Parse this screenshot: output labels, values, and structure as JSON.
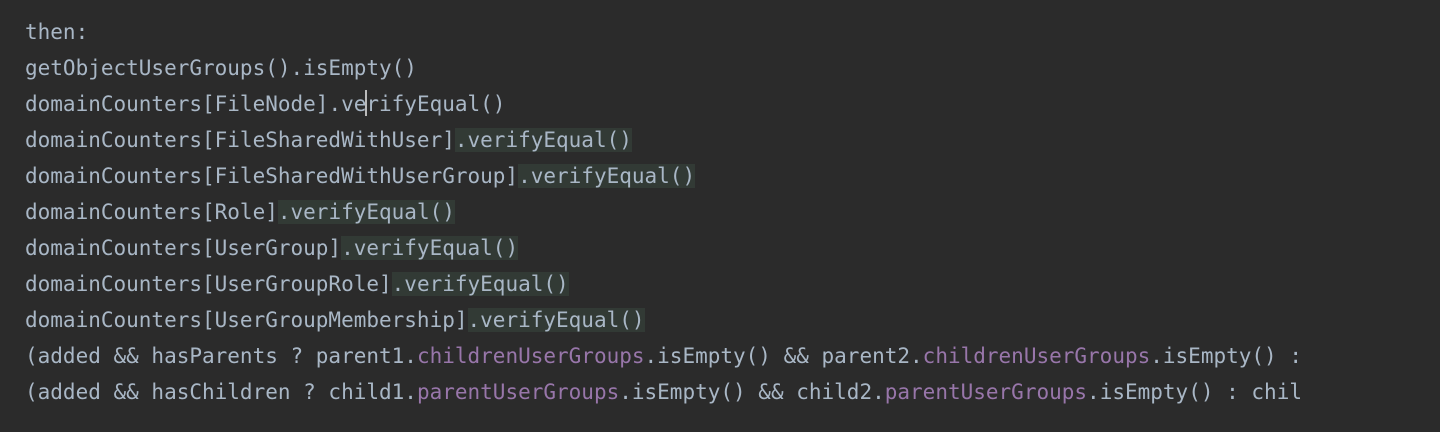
{
  "editor": {
    "lines": [
      {
        "segments": [
          {
            "text": "then:",
            "type": "plain"
          }
        ]
      },
      {
        "segments": [
          {
            "text": "getObjectUserGroups().isEmpty()",
            "type": "plain"
          }
        ]
      },
      {
        "segments": [
          {
            "text": "domainCounters[FileNode]",
            "type": "plain"
          },
          {
            "text": ".ve",
            "type": "plain"
          },
          {
            "text": "",
            "type": "caret"
          },
          {
            "text": "rifyEqual()",
            "type": "plain"
          }
        ]
      },
      {
        "segments": [
          {
            "text": "domainCounters[FileSharedWithUser]",
            "type": "plain"
          },
          {
            "text": ".verifyEqual()",
            "type": "highlight"
          }
        ]
      },
      {
        "segments": [
          {
            "text": "domainCounters[FileSharedWithUserGroup]",
            "type": "plain"
          },
          {
            "text": ".verifyEqual()",
            "type": "highlight"
          }
        ]
      },
      {
        "segments": [
          {
            "text": "domainCounters[Role]",
            "type": "plain"
          },
          {
            "text": ".verifyEqual()",
            "type": "highlight"
          }
        ]
      },
      {
        "segments": [
          {
            "text": "domainCounters[UserGroup]",
            "type": "plain"
          },
          {
            "text": ".verifyEqual()",
            "type": "highlight"
          }
        ]
      },
      {
        "segments": [
          {
            "text": "domainCounters[UserGroupRole]",
            "type": "plain"
          },
          {
            "text": ".verifyEqual()",
            "type": "highlight"
          }
        ]
      },
      {
        "segments": [
          {
            "text": "domainCounters[UserGroupMembership]",
            "type": "plain"
          },
          {
            "text": ".verifyEqual()",
            "type": "highlight"
          }
        ]
      },
      {
        "segments": [
          {
            "text": "(added && hasParents ? parent1.",
            "type": "plain"
          },
          {
            "text": "childrenUserGroups",
            "type": "field"
          },
          {
            "text": ".isEmpty() && parent2.",
            "type": "plain"
          },
          {
            "text": "childrenUserGroups",
            "type": "field"
          },
          {
            "text": ".isEmpty() :",
            "type": "plain"
          }
        ]
      },
      {
        "segments": [
          {
            "text": "(added && hasChildren ? child1.",
            "type": "plain"
          },
          {
            "text": "parentUserGroups",
            "type": "field"
          },
          {
            "text": ".isEmpty() && child2.",
            "type": "plain"
          },
          {
            "text": "parentUserGroups",
            "type": "field"
          },
          {
            "text": ".isEmpty() : chil",
            "type": "plain"
          }
        ]
      }
    ],
    "colors": {
      "background": "#2b2b2b",
      "text": "#a9b7c6",
      "field": "#9876aa",
      "highlight_background": "#323a35",
      "caret": "#bbbbbb"
    }
  }
}
